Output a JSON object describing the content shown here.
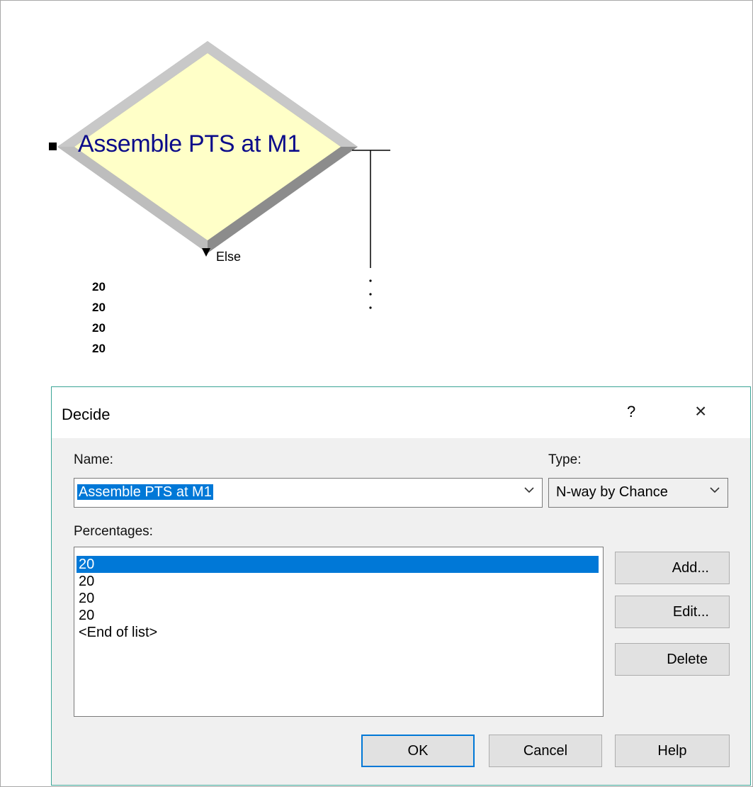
{
  "canvas": {
    "module_name": "Assemble PTS at M1",
    "else_label": "Else",
    "percentages": [
      "20",
      "20",
      "20",
      "20"
    ]
  },
  "dialog": {
    "title": "Decide",
    "help_label": "?",
    "close_label": "×",
    "name_label": "Name:",
    "name_value": "Assemble PTS at M1",
    "type_label": "Type:",
    "type_value": "N-way by Chance",
    "percentages_label": "Percentages:",
    "percentages_items": [
      "20",
      "20",
      "20",
      "20",
      "<End of list>"
    ],
    "selected_index": 0,
    "add_label": "Add...",
    "edit_label": "Edit...",
    "delete_label": "Delete",
    "ok_label": "OK",
    "cancel_label": "Cancel",
    "help_button_label": "Help"
  },
  "colors": {
    "diamond_fill": "#ffffc8",
    "module_text": "#0b0b8a",
    "selection": "#0078d7",
    "dialog_border": "#3aa596"
  }
}
